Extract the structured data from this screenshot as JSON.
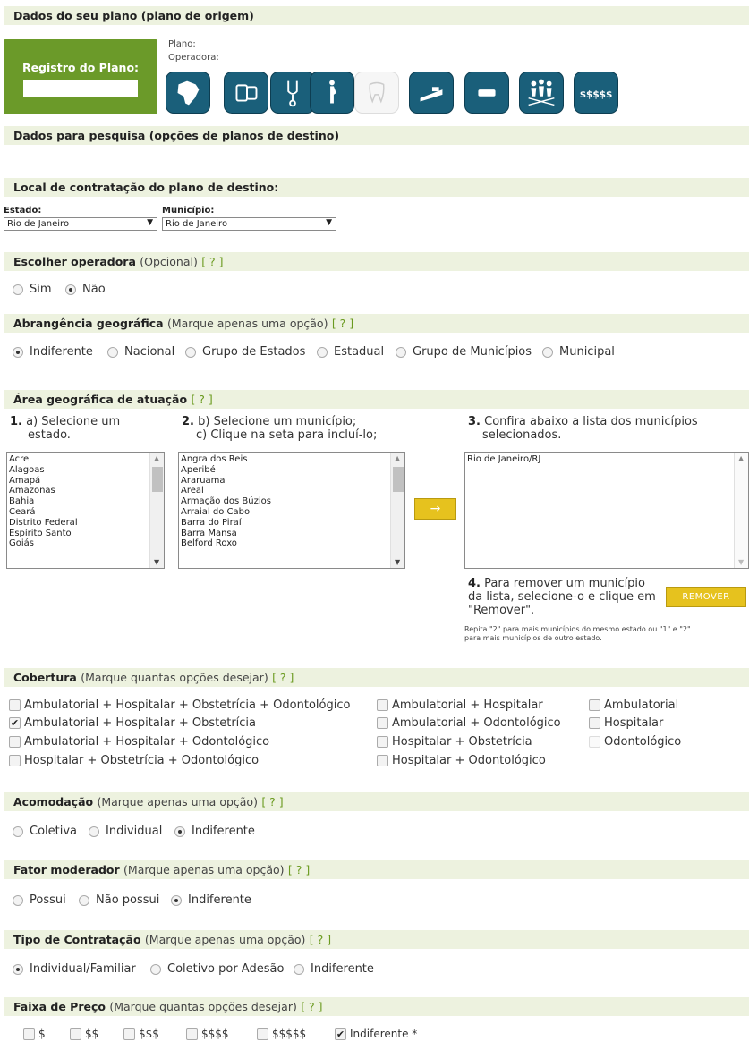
{
  "plan_section": {
    "title": "Dados do seu plano (plano de origem)",
    "registro_label": "Registro do Plano:",
    "registro_value": "",
    "plano_label": "Plano:",
    "operadora_label": "Operadora:",
    "icons": [
      "brazil-map-icon",
      "pills-icon",
      "stethoscope-icon",
      "pregnant-icon",
      "tooth-icon",
      "hospital-bed-icon",
      "equals-icon",
      "group-icon",
      "price-icon"
    ]
  },
  "search_section": {
    "title": "Dados para pesquisa (opções de planos de destino)"
  },
  "local": {
    "title": "Local de contratação do plano de destino:",
    "estado_label": "Estado:",
    "estado_value": "Rio de Janeiro",
    "municipio_label": "Município:",
    "municipio_value": "Rio de Janeiro"
  },
  "operadora": {
    "title": "Escolher operadora",
    "hint": "(Opcional)",
    "help": "[ ? ]",
    "options": [
      "Sim",
      "Não"
    ],
    "selected": "Não"
  },
  "abrangencia": {
    "title": "Abrangência geográfica",
    "hint": "(Marque apenas uma opção)",
    "help": "[ ? ]",
    "options": [
      "Indiferente",
      "Nacional",
      "Grupo de Estados",
      "Estadual",
      "Grupo de Municípios",
      "Municipal"
    ],
    "selected": "Indiferente"
  },
  "area": {
    "title": "Área geográfica de atuação",
    "help": "[ ? ]",
    "step1_num": "1.",
    "step1_text": "a) Selecione um",
    "step1_text2": "estado.",
    "step2_num": "2.",
    "step2_text": "b) Selecione um município;",
    "step2_text2": "c) Clique na seta para incluí-lo;",
    "step3_num": "3.",
    "step3_text": "Confira abaixo a lista dos municípios",
    "step3_text2": "selecionados.",
    "estados": [
      "Acre",
      "Alagoas",
      "Amapá",
      "Amazonas",
      "Bahia",
      "Ceará",
      "Distrito Federal",
      "Espírito Santo",
      "Goiás"
    ],
    "municipios": [
      "Angra dos Reis",
      "Aperibé",
      "Araruama",
      "Areal",
      "Armação dos Búzios",
      "Arraial do Cabo",
      "Barra do Piraí",
      "Barra Mansa",
      "Belford Roxo"
    ],
    "add_button": "→",
    "selecionados": [
      "Rio de Janeiro/RJ"
    ],
    "step4_num": "4.",
    "step4_text": "Para remover um município",
    "step4_text2": "da lista, selecione-o e clique em",
    "step4_text3": "\"Remover\".",
    "remove_button": "REMOVER",
    "note_line1": "Repita \"2\" para mais municípios do mesmo estado ou \"1\" e \"2\"",
    "note_line2": "para mais municípios de outro estado."
  },
  "cobertura": {
    "title": "Cobertura",
    "hint": "(Marque quantas opções desejar)",
    "help": "[ ? ]",
    "col1": [
      "Ambulatorial + Hospitalar + Obstetrícia + Odontológico",
      "Ambulatorial + Hospitalar + Obstetrícia",
      "Ambulatorial + Hospitalar + Odontológico",
      "Hospitalar + Obstetrícia + Odontológico"
    ],
    "col2": [
      "Ambulatorial + Hospitalar",
      "Ambulatorial + Odontológico",
      "Hospitalar + Obstetrícia",
      "Hospitalar + Odontológico"
    ],
    "col3": [
      "Ambulatorial",
      "Hospitalar",
      "Odontológico"
    ],
    "checked": "Ambulatorial + Hospitalar + Obstetrícia"
  },
  "acomodacao": {
    "title": "Acomodação",
    "hint": "(Marque apenas uma opção)",
    "help": "[ ? ]",
    "options": [
      "Coletiva",
      "Individual",
      "Indiferente"
    ],
    "selected": "Indiferente"
  },
  "fator": {
    "title": "Fator moderador",
    "hint": "(Marque apenas uma opção)",
    "help": "[ ? ]",
    "options": [
      "Possui",
      "Não possui",
      "Indiferente"
    ],
    "selected": "Indiferente"
  },
  "tipo": {
    "title": "Tipo de Contratação",
    "hint": "(Marque apenas uma opção)",
    "help": "[ ? ]",
    "options": [
      "Individual/Familiar",
      "Coletivo por Adesão",
      "Indiferente"
    ],
    "selected": "Individual/Familiar"
  },
  "faixa": {
    "title": "Faixa de Preço",
    "hint": "(Marque quantas opções desejar)",
    "help": "[ ? ]",
    "options": [
      "$",
      "$$",
      "$$$",
      "$$$$",
      "$$$$$",
      "Indiferente *"
    ],
    "checked": "Indiferente *"
  }
}
